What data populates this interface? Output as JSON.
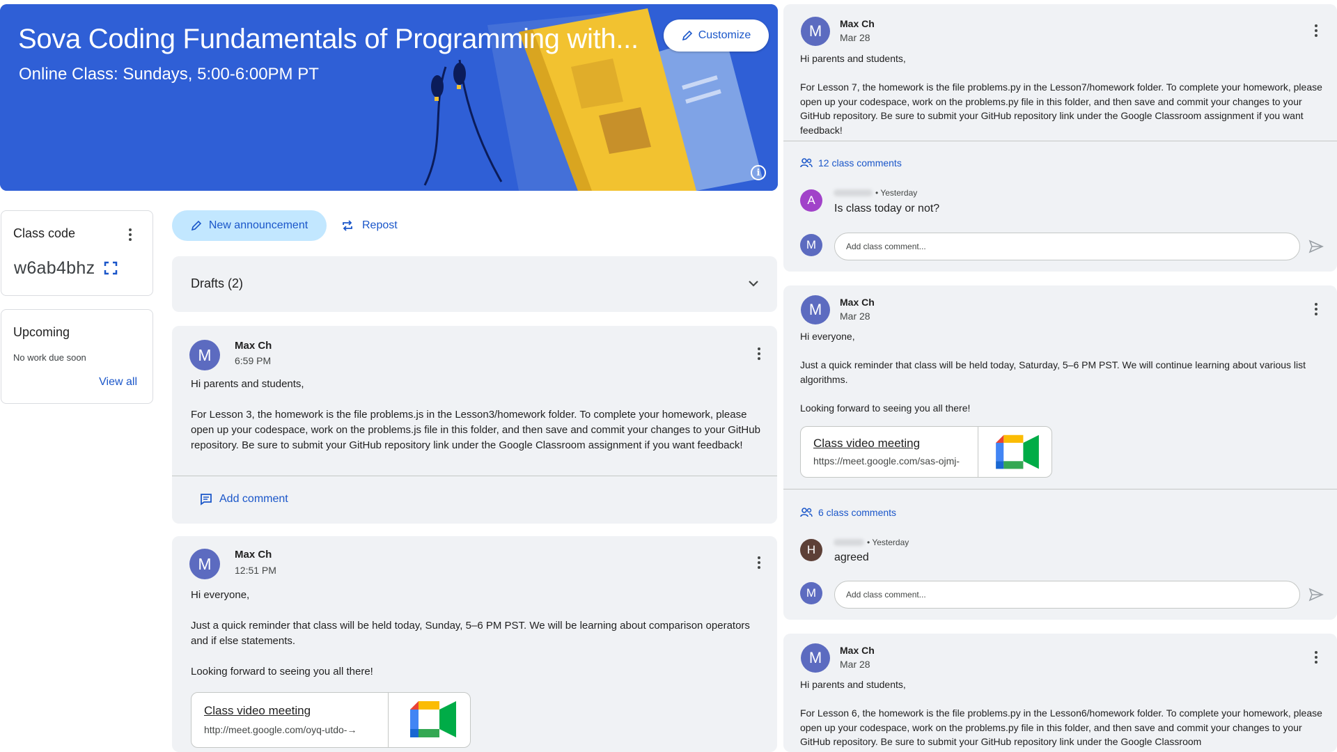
{
  "banner": {
    "title": "Sova Coding Fundamentals of Programming with...",
    "subtitle": "Online Class: Sundays, 5:00-6:00PM PT",
    "customize_label": "Customize"
  },
  "class_code": {
    "title": "Class code",
    "value": "w6ab4bhz"
  },
  "upcoming": {
    "title": "Upcoming",
    "empty_text": "No work due soon",
    "view_all": "View all"
  },
  "actions": {
    "new_announcement": "New announcement",
    "repost": "Repost"
  },
  "drafts": {
    "label": "Drafts (2)"
  },
  "colors": {
    "accent": "#1a56c9",
    "banner": "#2f5fd6",
    "avatar_teacher": "#5c6bc0",
    "avatar_a": "#a142c9",
    "avatar_h": "#5d4037",
    "post_bg": "#f0f2f5"
  },
  "stream_left": [
    {
      "avatar": "M",
      "author": "Max Ch",
      "time": "6:59 PM",
      "paragraphs": [
        "Hi parents and students,",
        "For Lesson 3, the homework is the file problems.js in the Lesson3/homework folder. To complete your homework, please open up your codespace, work on the problems.js file in this folder, and then save and commit your changes to your GitHub repository. Be sure to submit your GitHub repository link under the Google Classroom assignment if you want feedback!"
      ],
      "add_comment": "Add comment"
    },
    {
      "avatar": "M",
      "author": "Max Ch",
      "time": "12:51 PM",
      "paragraphs": [
        "Hi everyone,",
        "Just a quick reminder that class will be held today, Sunday, 5–6 PM PST. We will be learning about comparison operators and if else statements.",
        "Looking forward to seeing you all there!"
      ],
      "meet": {
        "title": "Class video meeting",
        "url": "http://meet.google.com/oyq-utdo-→"
      }
    }
  ],
  "stream_right": [
    {
      "avatar": "M",
      "author": "Max Ch",
      "time": "Mar 28",
      "paragraphs": [
        "Hi parents and students,",
        "For Lesson 7, the homework is the file problems.py in the Lesson7/homework folder. To complete your homework, please open up your codespace, work on the problems.py file in this folder, and then save and commit your changes to your GitHub repository. Be sure to submit your GitHub repository link under the Google Classroom assignment if you want feedback!"
      ],
      "class_comments": "12 class comments",
      "comment": {
        "avatar": "A",
        "time": "• Yesterday",
        "text": "Is class today or not?"
      },
      "input_placeholder": "Add class comment..."
    },
    {
      "avatar": "M",
      "author": "Max Ch",
      "time": "Mar 28",
      "paragraphs": [
        "Hi everyone,",
        "Just a quick reminder that class will be held today, Saturday, 5–6 PM PST. We will continue learning about various list algorithms.",
        "Looking forward to seeing you all there!"
      ],
      "meet": {
        "title": "Class video meeting",
        "url": "https://meet.google.com/sas-ojmj-"
      },
      "class_comments": "6 class comments",
      "comment": {
        "avatar": "H",
        "time": "• Yesterday",
        "text": "agreed"
      },
      "input_placeholder": "Add class comment..."
    },
    {
      "avatar": "M",
      "author": "Max Ch",
      "time": "Mar 28",
      "paragraphs": [
        "Hi parents and students,",
        "For Lesson 6, the homework is the file problems.py in the Lesson6/homework folder. To complete your homework, please open up your codespace, work on the problems.py file in this folder, and then save and commit your changes to your GitHub repository. Be sure to submit your GitHub repository link under the Google Classroom"
      ]
    }
  ]
}
